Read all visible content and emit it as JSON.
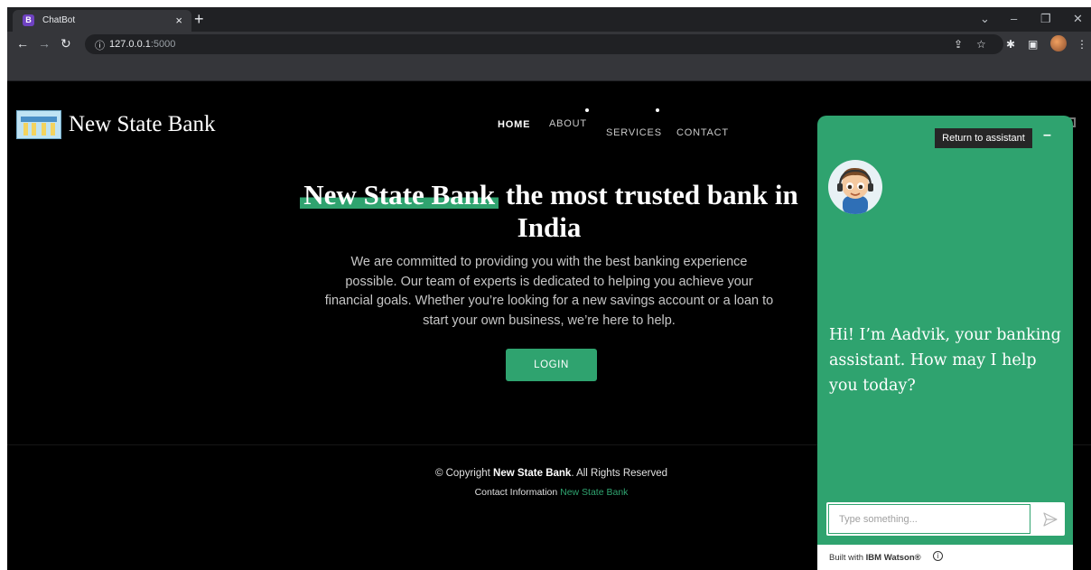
{
  "browser": {
    "tab_title": "ChatBot",
    "tab_favicon_letter": "B",
    "tab_close": "×",
    "new_tab": "+",
    "url_host": "127.0.0.1",
    "url_port": ":5000",
    "window_controls": [
      "⌄",
      "–",
      "❐",
      "✕"
    ],
    "nav_icons": [
      "arrow-left-icon",
      "arrow-right-icon",
      "reload-icon",
      "site-info-icon",
      "share-icon",
      "star-icon",
      "extensions-icon",
      "sidepanel-icon",
      "profile-avatar",
      "menu-icon"
    ]
  },
  "site": {
    "brand": "New State Bank",
    "nav": {
      "home": "HOME",
      "about": "ABOUT",
      "services": "SERVICES",
      "contact": "CONTACT"
    },
    "hero": {
      "title_highlight": "New State Bank",
      "title_rest": " the most trusted bank in India",
      "text": "We are committed to providing you with the best banking experience possible. Our team of experts is dedicated to helping you achieve your financial goals. Whether you’re looking for a new savings account or a loan to start your own business, we’re here to help.",
      "login_label": "LOGIN"
    },
    "footer": {
      "copyright_prefix": "© Copyright ",
      "copyright_brand": "New State Bank",
      "copyright_suffix": ". All Rights Reserved",
      "contact_prefix": "Contact Information ",
      "contact_link": "New State Bank"
    }
  },
  "chat": {
    "return_label": "Return to assistant",
    "minimize_label": "–",
    "message": "Hi! I’m Aadvik, your banking assistant. How may I help you today?",
    "input_placeholder": "Type something...",
    "built_prefix": "Built with ",
    "built_brand": "IBM Watson®",
    "info_glyph": "i"
  },
  "colors": {
    "accent": "#2fa36f",
    "page_bg": "#000000",
    "chrome_bg": "#202124"
  }
}
